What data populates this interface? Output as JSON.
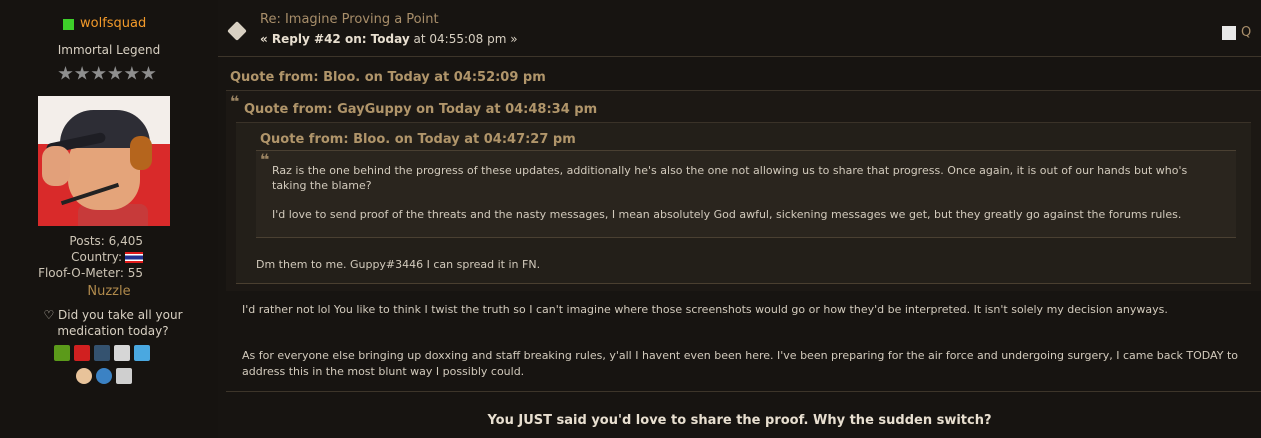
{
  "poster": {
    "username": "wolfsquad",
    "rank": "Immortal Legend",
    "posts_label": "Posts: 6,405",
    "country_label": "Country:",
    "floof_label": "Floof-O-Meter: 55",
    "custom_title": "Nuzzle",
    "personal_text": "♡ Did you take all your medication today?",
    "online_color": "#3ecf2a",
    "stars": 6,
    "profile_icons": [
      "xbox-icon",
      "youtube-icon",
      "tumblr-icon",
      "steam-icon",
      "twitter-icon"
    ],
    "action_icons": [
      "profile-icon",
      "website-icon",
      "message-icon"
    ]
  },
  "post": {
    "subject": "Re: Imagine Proving a Point",
    "reply_prefix": "« Reply #42 on: Today",
    "reply_time": " at 04:55:08 pm »",
    "quote_button_label": "Q",
    "quote1_header": "Quote from: Bloo. on Today at 04:52:09 pm",
    "quote2_header": "Quote from: GayGuppy on Today at 04:48:34 pm",
    "quote3_header": "Quote from: Bloo. on Today at 04:47:27 pm",
    "quote3_p1": "Raz is the one behind the progress of these updates, additionally he's also the one not allowing us to share that progress. Once again, it is out of our hands but who's taking the blame?",
    "quote3_p2": "I'd love to send proof of the threats and the nasty messages, I mean absolutely God awful, sickening messages we get, but they greatly go against the forums rules.",
    "quote2_reply": "Dm them to me. Guppy#3446  I can spread it in FN.",
    "quote1_p1": "I'd rather not lol You like to think I twist the truth so I can't imagine where those screenshots would go or how they'd be interpreted. It isn't solely my decision anyways.",
    "quote1_p2": "As for everyone else bringing up doxxing and staff breaking rules, y'all I havent even been here. I've been preparing for the air force and undergoing surgery, I came back TODAY to address this in the most blunt way I possibly could.",
    "reply_text": "You JUST said you'd love to share the proof. Why the sudden switch?"
  }
}
